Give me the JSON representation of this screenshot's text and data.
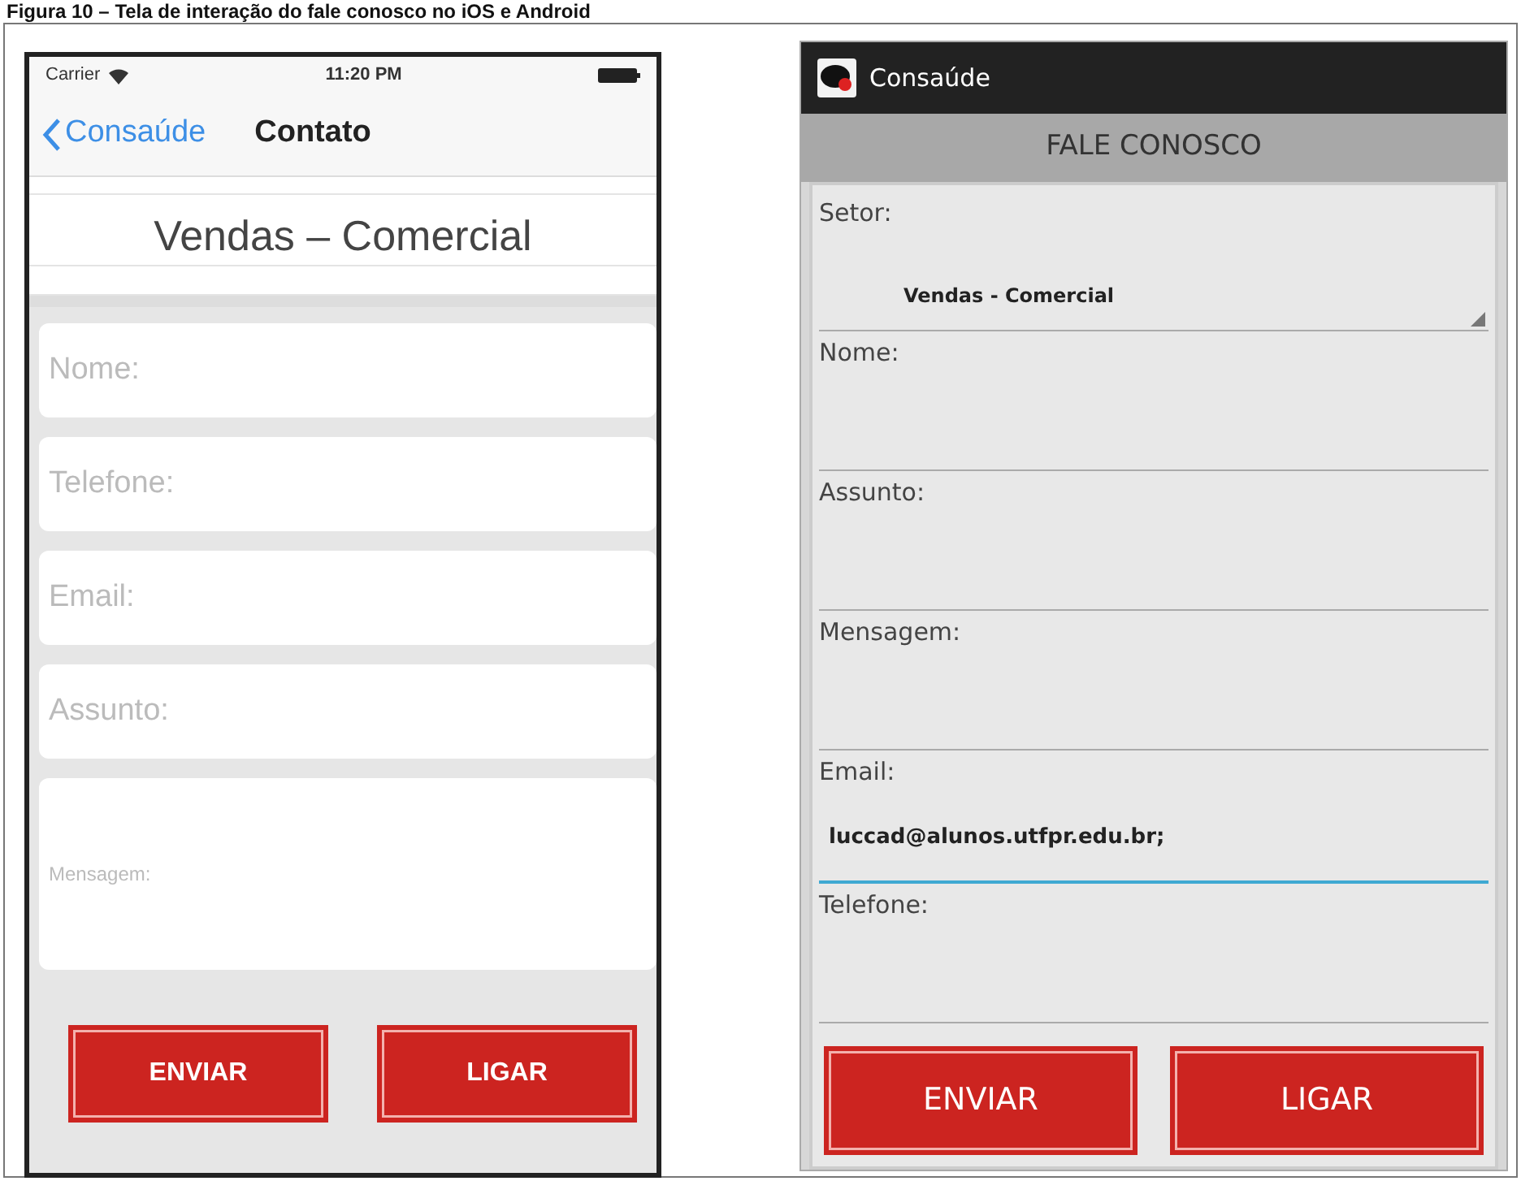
{
  "caption": "Figura 10 – Tela de interação do fale conosco no iOS e Android",
  "ios": {
    "status_bar": {
      "carrier": "Carrier",
      "time": "11:20 PM"
    },
    "nav": {
      "back": "Consaúde",
      "title": "Contato"
    },
    "picker": {
      "selected_value": "Vendas – Comercial"
    },
    "fields": [
      {
        "kind": "line",
        "placeholder": "Nome:"
      },
      {
        "kind": "line",
        "placeholder": "Telefone:"
      },
      {
        "kind": "line",
        "placeholder": "Email:"
      },
      {
        "kind": "line",
        "placeholder": "Assunto:"
      },
      {
        "kind": "area",
        "placeholder": "Mensagem:"
      }
    ],
    "buttons": [
      "ENVIAR",
      "LIGAR"
    ]
  },
  "android": {
    "app_title": "Consaúde",
    "header": "FALE CONOSCO",
    "fields": [
      {
        "kind": "spinner",
        "label": "Setor:",
        "value": "Vendas - Comercial",
        "focused": false
      },
      {
        "kind": "text",
        "label": "Nome:",
        "focused": false
      },
      {
        "kind": "text",
        "label": "Assunto:",
        "focused": false
      },
      {
        "kind": "text",
        "label": "Mensagem:",
        "focused": false
      },
      {
        "kind": "text",
        "label": "Email:",
        "value": "luccad@alunos.utfpr.edu.br;",
        "focused": true
      },
      {
        "kind": "text",
        "label": "Telefone:",
        "focused": false
      }
    ],
    "buttons": [
      "ENVIAR",
      "LIGAR"
    ]
  }
}
